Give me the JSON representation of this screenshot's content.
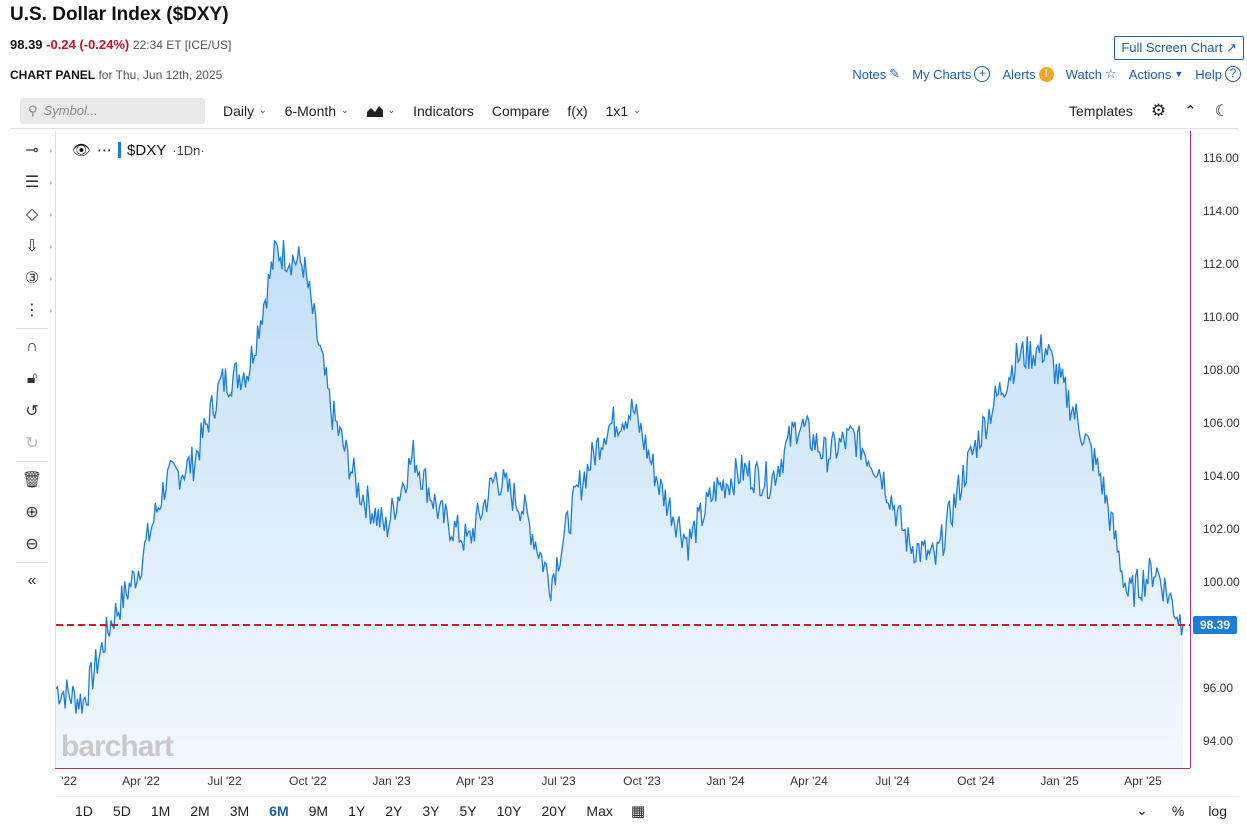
{
  "header": {
    "title": "U.S. Dollar Index ($DXY)",
    "price": "98.39",
    "change": "-0.24 (-0.24%)",
    "time": "22:34 ET [ICE/US]",
    "full_screen": "Full Screen Chart",
    "panel_label": "CHART PANEL",
    "panel_date": "for Thu, Jun 12th, 2025"
  },
  "links": {
    "notes": "Notes",
    "my_charts": "My Charts",
    "alerts": "Alerts",
    "alert_badge": "!",
    "watch": "Watch",
    "actions": "Actions",
    "help": "Help"
  },
  "toolbar": {
    "search_placeholder": "Symbol...",
    "interval": "Daily",
    "period": "6-Month",
    "indicators": "Indicators",
    "compare": "Compare",
    "fx": "f(x)",
    "layout": "1x1",
    "templates": "Templates"
  },
  "legend": {
    "symbol": "$DXY",
    "interval": "·1Dn·"
  },
  "watermark": "barchart",
  "y_ticks": [
    "116.00",
    "114.00",
    "112.00",
    "110.00",
    "108.00",
    "106.00",
    "104.00",
    "102.00",
    "100.00",
    "96.00",
    "94.00"
  ],
  "last_price_tag": "98.39",
  "x_ticks": [
    " '22",
    "Apr '22",
    "Jul '22",
    "Oct '22",
    "Jan '23",
    "Apr '23",
    "Jul '23",
    "Oct '23",
    "Jan '24",
    "Apr '24",
    "Jul '24",
    "Oct '24",
    "Jan '25",
    "Apr '25"
  ],
  "ranges": [
    "1D",
    "5D",
    "1M",
    "2M",
    "3M",
    "6M",
    "9M",
    "1Y",
    "2Y",
    "3Y",
    "5Y",
    "10Y",
    "20Y",
    "Max"
  ],
  "active_range": "6M",
  "bottom_right": {
    "percent": "%",
    "log": "log"
  },
  "colors": {
    "line": "#1b7fd9",
    "accent": "#1e5fa8",
    "last_price_line": "#d11a2a",
    "down": "#c8102e"
  },
  "chart_data": {
    "type": "area",
    "title": "U.S. Dollar Index ($DXY)",
    "y_range": [
      93,
      117
    ],
    "last_price": 98.39,
    "x": [
      "2022-01",
      "2022-02",
      "2022-03",
      "2022-04",
      "2022-05",
      "2022-06",
      "2022-07",
      "2022-08",
      "2022-09",
      "2022-10",
      "2022-11",
      "2022-12",
      "2023-01",
      "2023-02",
      "2023-03",
      "2023-04",
      "2023-05",
      "2023-06",
      "2023-07",
      "2023-08",
      "2023-09",
      "2023-10",
      "2023-11",
      "2023-12",
      "2024-01",
      "2024-02",
      "2024-03",
      "2024-04",
      "2024-05",
      "2024-06",
      "2024-07",
      "2024-08",
      "2024-09",
      "2024-10",
      "2024-11",
      "2024-12",
      "2025-01",
      "2025-02",
      "2025-03",
      "2025-04",
      "2025-05",
      "2025-06"
    ],
    "values": [
      96.0,
      95.5,
      98.5,
      100.5,
      103.8,
      104.5,
      107.5,
      108.0,
      112.5,
      112.0,
      106.5,
      103.5,
      102.0,
      104.8,
      102.5,
      101.5,
      104.0,
      102.8,
      100.0,
      103.5,
      105.8,
      106.5,
      103.5,
      101.5,
      103.5,
      104.2,
      103.8,
      106.0,
      104.8,
      105.5,
      104.2,
      101.5,
      100.8,
      104.0,
      106.5,
      108.5,
      108.8,
      106.5,
      104.0,
      99.5,
      100.5,
      98.39
    ]
  }
}
